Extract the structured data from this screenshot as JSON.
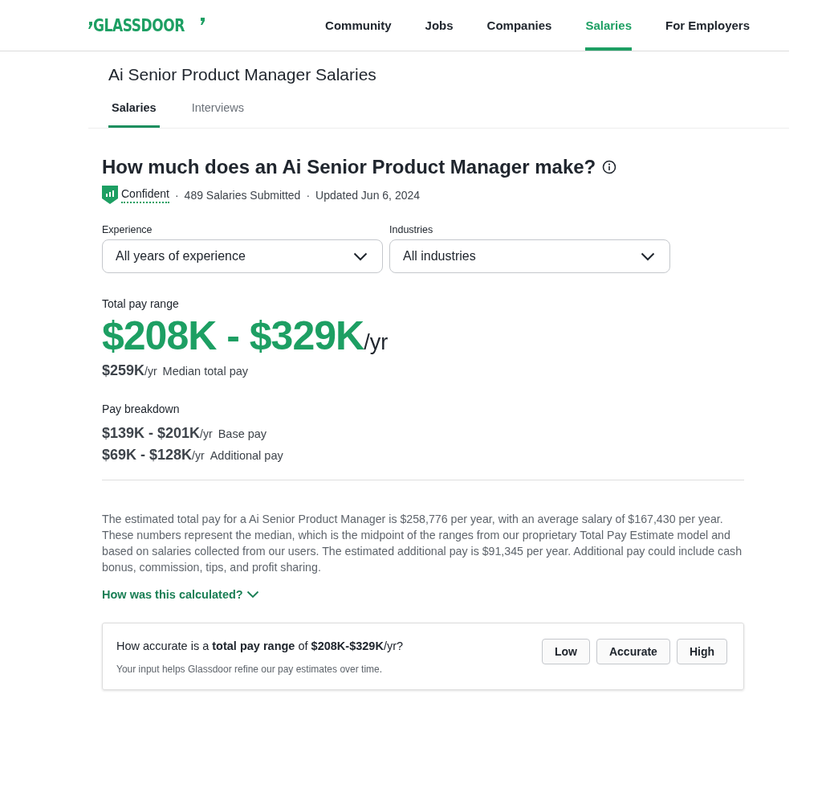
{
  "header": {
    "logo": "GLASSDOOR",
    "nav": [
      {
        "label": "Community",
        "selected": false
      },
      {
        "label": "Jobs",
        "selected": false
      },
      {
        "label": "Companies",
        "selected": false
      },
      {
        "label": "Salaries",
        "selected": true
      },
      {
        "label": "For Employers",
        "selected": false
      }
    ]
  },
  "page": {
    "title": "Ai Senior Product Manager Salaries",
    "tabs": [
      {
        "label": "Salaries",
        "selected": true
      },
      {
        "label": "Interviews",
        "selected": false
      }
    ]
  },
  "summary": {
    "heading": "How much does an Ai Senior Product Manager make?",
    "meta": [
      {
        "kind": "confidence",
        "text": "Confident"
      },
      {
        "kind": "separator",
        "text": "·"
      },
      {
        "kind": "text",
        "text": "489 Salaries Submitted"
      },
      {
        "kind": "separator",
        "text": "·"
      },
      {
        "kind": "text",
        "text": "Updated Jun 6, 2024"
      }
    ],
    "filters": [
      {
        "label": "Experience",
        "value": "All years of experience"
      },
      {
        "label": "Industries",
        "value": "All industries"
      }
    ],
    "total": {
      "label": "Total pay range",
      "amount": "$208K - $329K",
      "unit": "/yr"
    },
    "median": {
      "amount": "$259K",
      "unit": "/yr",
      "label": "Median total pay"
    },
    "breakdown": {
      "label": "Pay breakdown",
      "rows": [
        {
          "amount": "$139K - $201K",
          "unit": "/yr",
          "label": "Base pay"
        },
        {
          "amount": "$69K - $128K",
          "unit": "/yr",
          "label": "Additional pay"
        }
      ]
    },
    "description": "The estimated total pay for a Ai Senior Product Manager is $258,776 per year, with an average salary of $167,430 per year. These numbers represent the median, which is the midpoint of the ranges from our proprietary Total Pay Estimate model and based on salaries collected from our users. The estimated additional pay is $91,345 per year. Additional pay could include cash bonus, commission, tips, and profit sharing.",
    "calc_link": "How was this calculated?"
  },
  "feedback": {
    "question": "How accurate is a **total pay range** of **$208K-$329K**/yr?",
    "note": "Your input helps Glassdoor refine our pay estimates over time.",
    "options": [
      "Low",
      "Accurate",
      "High"
    ]
  }
}
